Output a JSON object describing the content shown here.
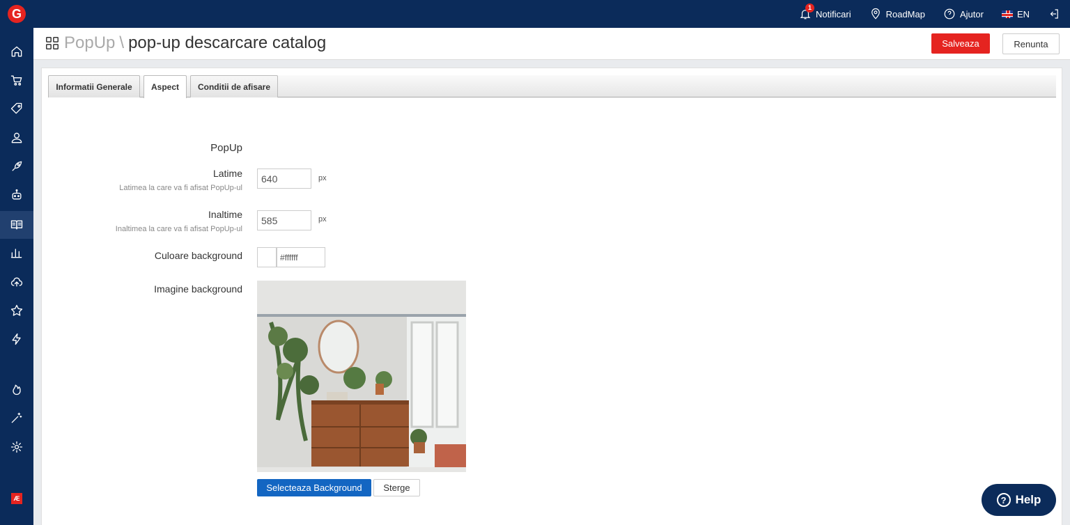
{
  "app": {
    "logo_letter": "G"
  },
  "topbar": {
    "notifications": {
      "label": "Notificari",
      "count": "1",
      "icon": "bell-icon"
    },
    "roadmap": {
      "label": "RoadMap",
      "icon": "map-pin-icon"
    },
    "help": {
      "label": "Ajutor",
      "icon": "question-circle-icon"
    },
    "language": {
      "label": "EN",
      "icon": "uk-flag-icon"
    },
    "logout": {
      "icon": "logout-icon"
    }
  },
  "sidebar": {
    "items": [
      {
        "icon": "home-icon"
      },
      {
        "icon": "cart-icon"
      },
      {
        "icon": "tag-icon"
      },
      {
        "icon": "users-icon"
      },
      {
        "icon": "rocket-icon"
      },
      {
        "icon": "robot-icon"
      },
      {
        "icon": "catalog-book-icon",
        "active": true
      },
      {
        "icon": "chart-icon"
      },
      {
        "icon": "cloud-upload-icon"
      },
      {
        "icon": "star-icon"
      },
      {
        "icon": "lightning-icon"
      },
      {
        "icon": "flame-icon"
      },
      {
        "icon": "magic-wand-icon"
      },
      {
        "icon": "gear-icon"
      }
    ],
    "footer_badge": "Æ"
  },
  "header": {
    "section": "PopUp",
    "separator": "\\",
    "title": "pop-up descarcare catalog",
    "save_label": "Salveaza",
    "cancel_label": "Renunta"
  },
  "tabs": [
    {
      "label": "Informatii Generale"
    },
    {
      "label": "Aspect",
      "active": true
    },
    {
      "label": "Conditii de afisare"
    }
  ],
  "form": {
    "section_title": "PopUp",
    "width": {
      "label": "Latime",
      "help": "Latimea la care va fi afisat PopUp-ul",
      "value": "640",
      "unit": "px"
    },
    "height": {
      "label": "Inaltime",
      "help": "Inaltimea la care va fi afisat PopUp-ul",
      "value": "585",
      "unit": "px"
    },
    "bg_color": {
      "label": "Culoare background",
      "value": "#ffffff",
      "swatch": "#ffffff"
    },
    "bg_image": {
      "label": "Imagine background",
      "select_label": "Selecteaza Background",
      "delete_label": "Sterge"
    }
  },
  "help_button": {
    "label": "Help",
    "glyph": "?"
  },
  "colors": {
    "navy": "#0b2b5a",
    "red": "#e52420",
    "blue": "#1366c2"
  }
}
